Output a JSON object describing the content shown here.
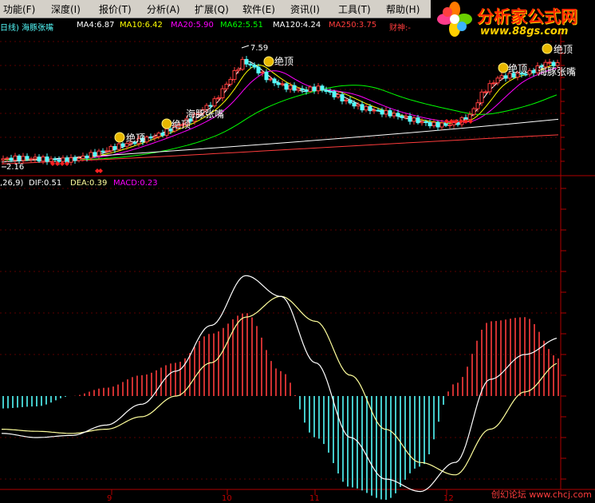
{
  "menu": [
    "功能(F)",
    "深度(I)",
    "报价(T)",
    "分析(A)",
    "扩展(Q)",
    "软件(E)",
    "资讯(I)",
    "工具(T)",
    "帮助(H)"
  ],
  "brand": {
    "title": "分析家公式网",
    "url": "www.88gs.com"
  },
  "ma_legend": {
    "chart_name": "日线) 海豚张嘴",
    "items": [
      {
        "text": "MA4:6.87",
        "color": "#ffffff"
      },
      {
        "text": "MA10:6.42",
        "color": "#ffff00"
      },
      {
        "text": "MA20:5.90",
        "color": "#ff00ff"
      },
      {
        "text": "MA62:5.51",
        "color": "#00ff00"
      },
      {
        "text": "MA120:4.24",
        "color": "#ffffff"
      },
      {
        "text": "MA250:3.75",
        "color": "#ff3c3c"
      },
      {
        "text": "财神:-",
        "color": "#ff3c3c"
      }
    ]
  },
  "price_labels": {
    "high": "7.59",
    "low": "2.16"
  },
  "signals": [
    {
      "label": "绝顶"
    },
    {
      "label": "绝顶"
    },
    {
      "label": "海豚张嘴"
    },
    {
      "label": "绝顶"
    },
    {
      "label": "绝顶"
    },
    {
      "label": "海豚张嘴"
    },
    {
      "label": "绝顶"
    }
  ],
  "macd_legend": {
    "params": ",26,9)",
    "dif": "DIF:0.51",
    "dea": "DEA:0.39",
    "macd": "MACD:0.23"
  },
  "x_axis_labels": [
    "9",
    "10",
    "11",
    "12"
  ],
  "watermark": "创幻论坛 www.chcj.com",
  "colors": {
    "up": "#ff3c3c",
    "down": "#54fcfc",
    "axis": "#b00000",
    "dif": "#ffffff",
    "dea": "#ffff9c",
    "ma20": "#ff00ff"
  },
  "chart_data": [
    {
      "type": "candlestick",
      "title": "海豚张嘴",
      "ylim": [
        1.6,
        8.6
      ],
      "annotations": [
        "7.59",
        "2.16"
      ]
    },
    {
      "type": "bar",
      "title": "MACD",
      "series": [
        {
          "name": "DIF",
          "values": [
            -0.9,
            -1.0,
            -0.95,
            -0.7,
            -0.2,
            0.6,
            1.7,
            2.9,
            2.4,
            0.8,
            -1.0,
            -2.0,
            -2.3,
            -1.6,
            0.4,
            1.0,
            1.4
          ]
        },
        {
          "name": "DEA",
          "values": [
            -0.8,
            -0.85,
            -0.9,
            -0.8,
            -0.5,
            0.0,
            0.8,
            1.9,
            2.4,
            1.8,
            0.5,
            -0.8,
            -1.6,
            -1.9,
            -0.8,
            0.1,
            0.8
          ]
        },
        {
          "name": "MACD",
          "values": [
            -0.3,
            -0.25,
            0.0,
            0.2,
            0.5,
            0.8,
            1.5,
            2.0,
            0.6,
            -1.0,
            -2.2,
            -2.5,
            -1.7,
            0.3,
            1.8,
            1.9,
            0.9
          ]
        }
      ]
    }
  ]
}
